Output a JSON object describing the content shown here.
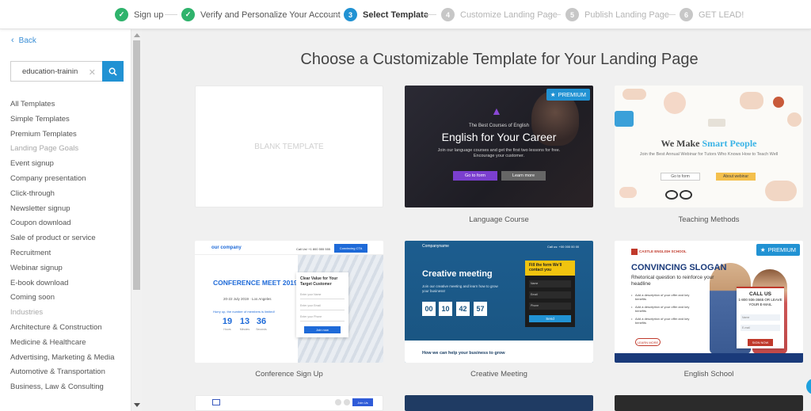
{
  "stepper": [
    {
      "num": "✓",
      "label": "Sign up",
      "state": "done"
    },
    {
      "num": "✓",
      "label": "Verify and Personalize Your Account",
      "state": "done"
    },
    {
      "num": "3",
      "label": "Select Template",
      "state": "active"
    },
    {
      "num": "4",
      "label": "Customize Landing Page",
      "state": "pending"
    },
    {
      "num": "5",
      "label": "Publish Landing Page",
      "state": "pending"
    },
    {
      "num": "6",
      "label": "GET LEAD!",
      "state": "pending"
    }
  ],
  "sidebar": {
    "back_label": "Back",
    "search_value": "education-trainin",
    "items": [
      {
        "label": "All Templates",
        "heading": false
      },
      {
        "label": "Simple Templates",
        "heading": false
      },
      {
        "label": "Premium Templates",
        "heading": false
      },
      {
        "label": "Landing Page Goals",
        "heading": true
      },
      {
        "label": "Event signup",
        "heading": false
      },
      {
        "label": "Company presentation",
        "heading": false
      },
      {
        "label": "Click-through",
        "heading": false
      },
      {
        "label": "Newsletter signup",
        "heading": false
      },
      {
        "label": "Coupon download",
        "heading": false
      },
      {
        "label": "Sale of product or service",
        "heading": false
      },
      {
        "label": "Recruitment",
        "heading": false
      },
      {
        "label": "Webinar signup",
        "heading": false
      },
      {
        "label": "E-book download",
        "heading": false
      },
      {
        "label": "Coming soon",
        "heading": false
      },
      {
        "label": "Industries",
        "heading": true
      },
      {
        "label": "Architecture & Construction",
        "heading": false
      },
      {
        "label": "Medicine & Healthcare",
        "heading": false
      },
      {
        "label": "Advertising, Marketing & Media",
        "heading": false
      },
      {
        "label": "Automotive & Transportation",
        "heading": false
      },
      {
        "label": "Business, Law & Consulting",
        "heading": false
      }
    ]
  },
  "main": {
    "title": "Choose a Customizable Template for Your Landing Page",
    "premium_label": "PREMIUM",
    "blank": {
      "label": "BLANK TEMPLATE"
    },
    "language": {
      "caption": "Language Course",
      "line1": "The Best Courses of English",
      "headline": "English for Your Career",
      "sub": "Join our language courses and get the first two lessons for free. Encourage your customer.",
      "btn1": "Go to form",
      "btn2": "Learn more"
    },
    "teaching": {
      "caption": "Teaching Methods",
      "headline_a": "We Make ",
      "headline_b": "Smart People",
      "sub": "Join the Best Annual Webinar for Tutors Who Knows How to Teach Well",
      "btn1": "Go to form",
      "btn2": "About webinar"
    },
    "conference": {
      "caption": "Conference Sign Up",
      "logo": "our company",
      "call": "Call Us! +1 800 555 555",
      "cta": "Convincing CTA",
      "headline": "CONFERENCE MEET 2019",
      "date": "20-22 July 2019 · Los Angeles",
      "note": "Hurry up, the number of members is limited!",
      "count": [
        {
          "v": "19",
          "l": "Hours"
        },
        {
          "v": "13",
          "l": "Minutes"
        },
        {
          "v": "36",
          "l": "Seconds"
        }
      ],
      "form_title": "Clear Value for Your Target Customer",
      "fields": [
        "Enter your Name",
        "Enter your Email",
        "Enter your Phone"
      ],
      "form_btn": "Join now"
    },
    "creative": {
      "caption": "Creative Meeting",
      "logo": "Companyname",
      "call": "Call us: +00 000 00 00",
      "headline": "Creative meeting",
      "sub": "Join our creative meeting and learn how to grow your business!",
      "count": [
        "00",
        "10",
        "42",
        "57"
      ],
      "form_title": "Fill the form We'll contact you",
      "fields": [
        "Name",
        "Email",
        "Phone"
      ],
      "form_btn": "Send",
      "bottom": "How we can help your business to grow"
    },
    "english": {
      "caption": "English School",
      "logo": "CASTLE ENGLISH SCHOOL",
      "headline": "CONVINCING SLOGAN",
      "sub": "Rhetorical question to reinforce your headline",
      "bullets": [
        "Add a description of your offer and key benefits",
        "Add a description of your offer and key benefits",
        "Add a description of your offer and key benefits"
      ],
      "btn": "LEARN MORE",
      "call": "CALL US",
      "phone": "1-800 936-3665 OR LEAVE YOUR E-MAIL",
      "fields": [
        "Name",
        "E-mail"
      ],
      "form_btn": "SIGN NOW"
    },
    "partial": {
      "btn": "Join Us"
    }
  }
}
